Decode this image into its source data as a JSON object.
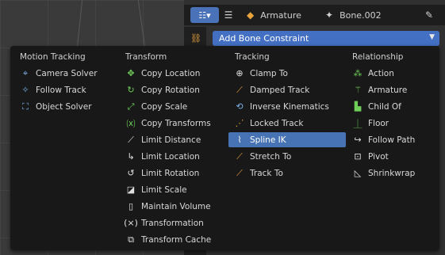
{
  "header": {
    "object_name": "Armature",
    "bone_name": "Bone.002"
  },
  "add_constraint_label": "Add Bone Constraint",
  "menu": {
    "columns": [
      {
        "title": "Motion Tracking",
        "items": [
          {
            "label": "Camera Solver",
            "icon": "camera-solver-icon"
          },
          {
            "label": "Follow Track",
            "icon": "follow-track-icon"
          },
          {
            "label": "Object Solver",
            "icon": "object-solver-icon"
          }
        ]
      },
      {
        "title": "Transform",
        "items": [
          {
            "label": "Copy Location",
            "icon": "copy-location-icon"
          },
          {
            "label": "Copy Rotation",
            "icon": "copy-rotation-icon"
          },
          {
            "label": "Copy Scale",
            "icon": "copy-scale-icon"
          },
          {
            "label": "Copy Transforms",
            "icon": "copy-transforms-icon"
          },
          {
            "label": "Limit Distance",
            "icon": "limit-distance-icon"
          },
          {
            "label": "Limit Location",
            "icon": "limit-location-icon"
          },
          {
            "label": "Limit Rotation",
            "icon": "limit-rotation-icon"
          },
          {
            "label": "Limit Scale",
            "icon": "limit-scale-icon"
          },
          {
            "label": "Maintain Volume",
            "icon": "maintain-volume-icon"
          },
          {
            "label": "Transformation",
            "icon": "transformation-icon"
          },
          {
            "label": "Transform Cache",
            "icon": "transform-cache-icon"
          }
        ]
      },
      {
        "title": "Tracking",
        "items": [
          {
            "label": "Clamp To",
            "icon": "clamp-to-icon"
          },
          {
            "label": "Damped Track",
            "icon": "damped-track-icon"
          },
          {
            "label": "Inverse Kinematics",
            "icon": "inverse-kinematics-icon"
          },
          {
            "label": "Locked Track",
            "icon": "locked-track-icon"
          },
          {
            "label": "Spline IK",
            "icon": "spline-ik-icon",
            "selected": true
          },
          {
            "label": "Stretch To",
            "icon": "stretch-to-icon"
          },
          {
            "label": "Track To",
            "icon": "track-to-icon"
          }
        ]
      },
      {
        "title": "Relationship",
        "items": [
          {
            "label": "Action",
            "icon": "action-icon"
          },
          {
            "label": "Armature",
            "icon": "armature-icon"
          },
          {
            "label": "Child Of",
            "icon": "child-of-icon"
          },
          {
            "label": "Floor",
            "icon": "floor-icon"
          },
          {
            "label": "Follow Path",
            "icon": "follow-path-icon"
          },
          {
            "label": "Pivot",
            "icon": "pivot-icon"
          },
          {
            "label": "Shrinkwrap",
            "icon": "shrinkwrap-icon"
          }
        ]
      }
    ]
  },
  "colors": {
    "accent": "#4772b3",
    "menu_bg": "#181818",
    "icon_accent": "#e8a33d",
    "icon_green": "#6fcf5a"
  }
}
